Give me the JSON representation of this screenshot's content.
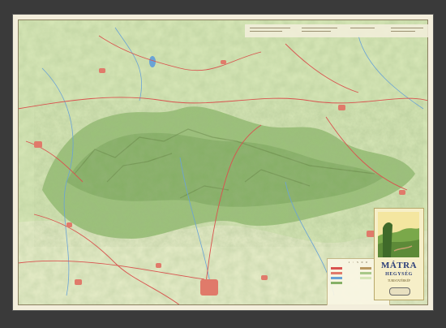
{
  "title": "MÁTRA",
  "subtitle": "HEGYSÉG",
  "tagline": "TURISTATÉRKÉP",
  "legend_header": "1 : 5 0 0",
  "colors": {
    "background": "#3a3a3a",
    "paper": "#f3eedc",
    "lowland": "#cfe3b0",
    "forest": "#9cc27a",
    "ridge_shadow": "#6f8f4e",
    "road": "#d9534f",
    "town": "#e07a6a",
    "water": "#6aa3d6",
    "title_blue": "#2c3f7a"
  },
  "icons": [
    "road-network",
    "settlement",
    "river",
    "lake",
    "relief-shading"
  ]
}
